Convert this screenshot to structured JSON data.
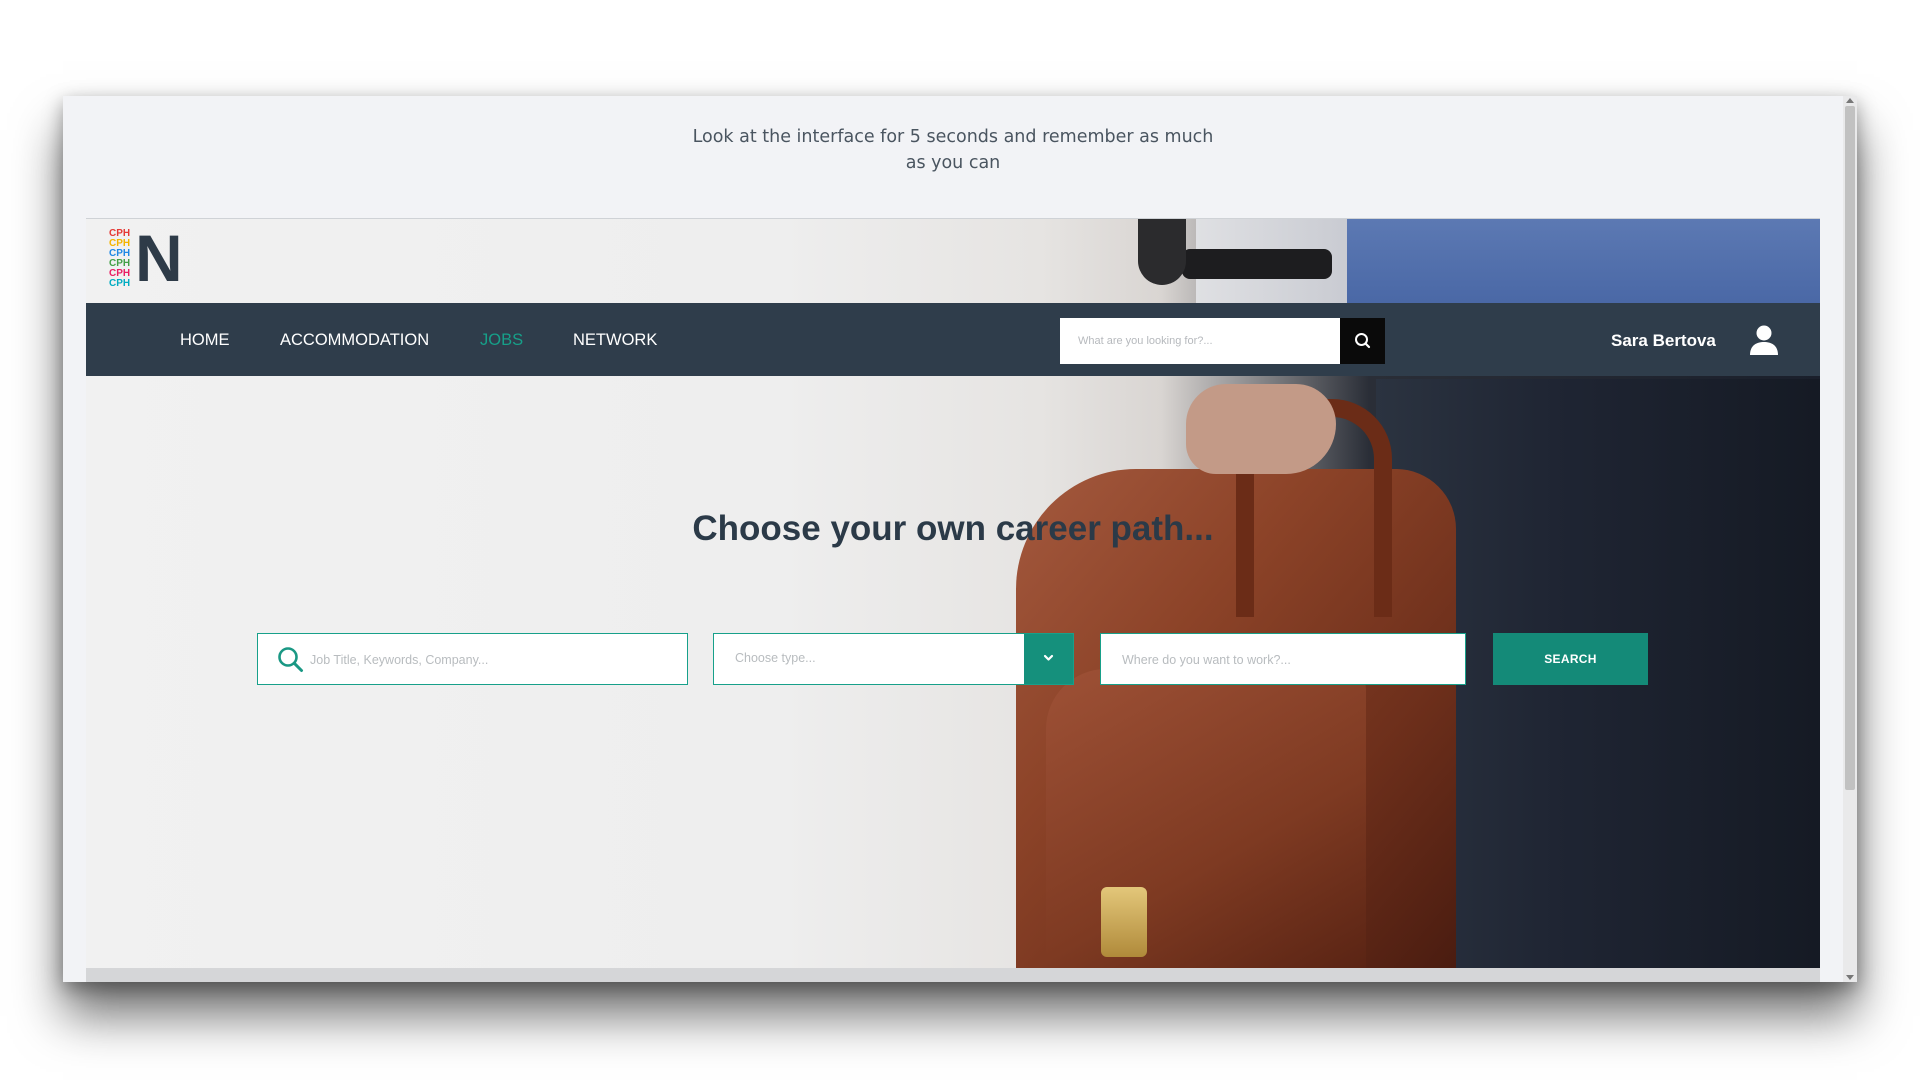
{
  "instruction": {
    "text": "Look at the interface for 5 seconds and remember as much as you can"
  },
  "logo": {
    "cph_lines": [
      "CPH",
      "CPH",
      "CPH",
      "CPH",
      "CPH",
      "CPH"
    ],
    "cph_colors": [
      "#e53935",
      "#f4b400",
      "#1e88e5",
      "#43a047",
      "#e91e63",
      "#00acc1"
    ],
    "letter": "N"
  },
  "nav": {
    "items": [
      {
        "label": "HOME",
        "active": false
      },
      {
        "label": "ACCOMMODATION",
        "active": false
      },
      {
        "label": "JOBS",
        "active": true
      },
      {
        "label": "NETWORK",
        "active": false
      }
    ],
    "search_placeholder": "What are you looking for?...",
    "search_icon": "search-icon",
    "user_name": "Sara Bertova",
    "user_icon": "user-icon"
  },
  "hero": {
    "headline": "Choose your own career path...",
    "keyword_placeholder": "Job Title, Keywords, Company...",
    "type_value": "Choose type...",
    "location_placeholder": "Where do you want to work?...",
    "search_label": "SEARCH"
  },
  "colors": {
    "nav_background": "#2f3d4b",
    "accent": "#15907c",
    "active_nav": "#16a089",
    "headline": "#2b3a48"
  }
}
